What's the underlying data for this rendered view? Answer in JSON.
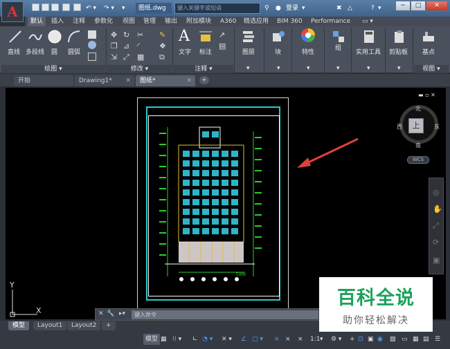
{
  "titlebar": {
    "doc_title": "图纸.dwg",
    "search_placeholder": "键入关键字或短语",
    "login": "登录",
    "help": "?",
    "minimize": "−",
    "restore": "□",
    "close": "✕"
  },
  "ribbon_tabs": [
    "默认",
    "插入",
    "注释",
    "参数化",
    "视图",
    "管理",
    "输出",
    "附加模块",
    "A360",
    "精选应用",
    "BIM 360",
    "Performance"
  ],
  "ribbon": {
    "draw_tools": [
      "直线",
      "多段线",
      "圆",
      "圆弧"
    ],
    "panel_draw": "绘图 ▾",
    "panel_modify": "修改 ▾",
    "annot_tools": [
      "文字",
      "标注"
    ],
    "panel_annot": "注释 ▾",
    "layer": "图层",
    "block": "块",
    "properties": "特性",
    "group": "组",
    "utilities": "实用工具",
    "clipboard": "剪贴板",
    "base": "基点",
    "panel_view": "视图 ▾"
  },
  "doc_tabs": [
    "开始",
    "Drawing1*",
    "图纸*"
  ],
  "viewcube": {
    "north": "北",
    "south": "南",
    "east": "东",
    "west": "西",
    "face": "上",
    "wcs": "WCS"
  },
  "drawing": {
    "caption": "立面图",
    "axis_y": "Y",
    "axis_x": "X"
  },
  "command": {
    "placeholder": "键入命令"
  },
  "layout_tabs": [
    "模型",
    "Layout1",
    "Layout2",
    "+"
  ],
  "status": {
    "model": "模型",
    "scale": "1:1"
  },
  "watermark": {
    "title": "百科全说",
    "subtitle": "助你轻松解决"
  },
  "colors": {
    "accent": "#1aa35a",
    "canvas": "#000000",
    "ribbon": "#4a515c",
    "arrow": "#e0403a"
  }
}
